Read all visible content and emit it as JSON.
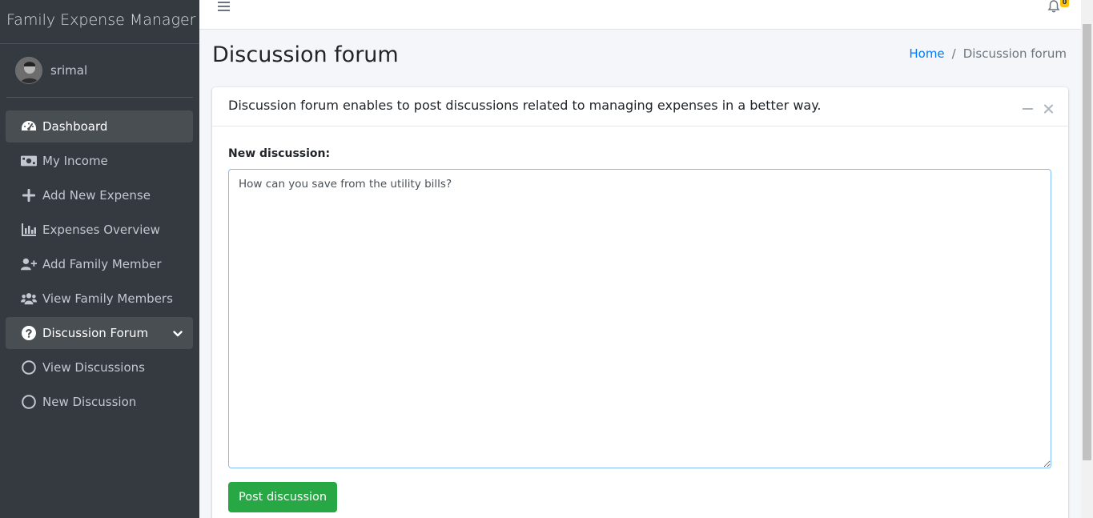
{
  "app": {
    "title": "Family Expense Manager"
  },
  "user": {
    "name": "srimal"
  },
  "sidebar": {
    "items": [
      {
        "label": "Dashboard",
        "icon": "tachometer-icon"
      },
      {
        "label": "My Income",
        "icon": "money-bill-icon"
      },
      {
        "label": "Add New Expense",
        "icon": "plus-icon"
      },
      {
        "label": "Expenses Overview",
        "icon": "chart-bar-icon"
      },
      {
        "label": "Add Family Member",
        "icon": "user-plus-icon"
      },
      {
        "label": "View Family Members",
        "icon": "users-icon"
      },
      {
        "label": "Discussion Forum",
        "icon": "question-circle-icon"
      },
      {
        "label": "View Discussions",
        "icon": "circle-icon"
      },
      {
        "label": "New Discussion",
        "icon": "circle-icon"
      }
    ]
  },
  "topbar": {
    "notification_count": "0"
  },
  "header": {
    "title": "Discussion forum",
    "breadcrumb": {
      "home": "Home",
      "separator": "/",
      "current": "Discussion forum"
    }
  },
  "card": {
    "description": "Discussion forum enables to post discussions related to managing expenses in a better way.",
    "form_label": "New discussion:",
    "textarea_value": "How can you save from the utility bills?",
    "submit_label": "Post discussion"
  },
  "colors": {
    "sidebar_bg": "#343a40",
    "active_item_bg": "#494e53",
    "link": "#007bff",
    "success": "#28a745",
    "badge": "#ffc107"
  }
}
